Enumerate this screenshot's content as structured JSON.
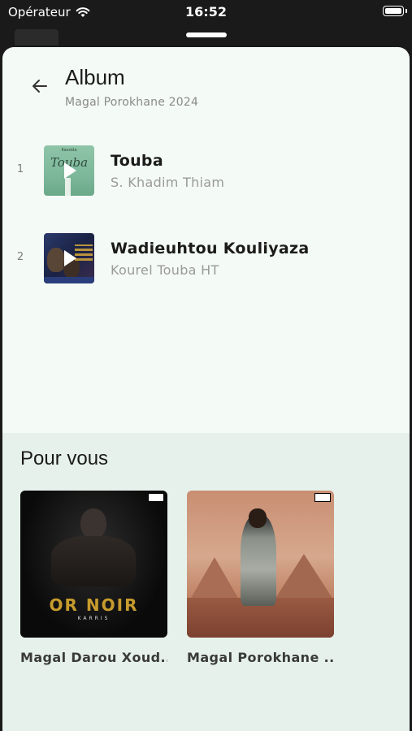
{
  "status_bar": {
    "carrier": "Opérateur",
    "time": "16:52"
  },
  "header": {
    "title": "Album",
    "subtitle": "Magal Porokhane 2024"
  },
  "tracks": [
    {
      "number": "1",
      "title": "Touba",
      "artist": "S. Khadim Thiam",
      "art_text": "Touba",
      "art_small": "Kassida"
    },
    {
      "number": "2",
      "title": "Wadieuhtou Kouliyaza",
      "artist": "Kourel Touba HT"
    }
  ],
  "pour_vous": {
    "title": "Pour vous",
    "items": [
      {
        "label": "Magal Darou Xoud...",
        "art_text": "OR NOIR",
        "art_sub": "KARRIS"
      },
      {
        "label": "Magal Porokhane ..."
      }
    ]
  },
  "colors": {
    "sheet_bg": "#f4faf6",
    "section_bg": "#e6f1eb",
    "accent_gold": "#c79b2d"
  }
}
